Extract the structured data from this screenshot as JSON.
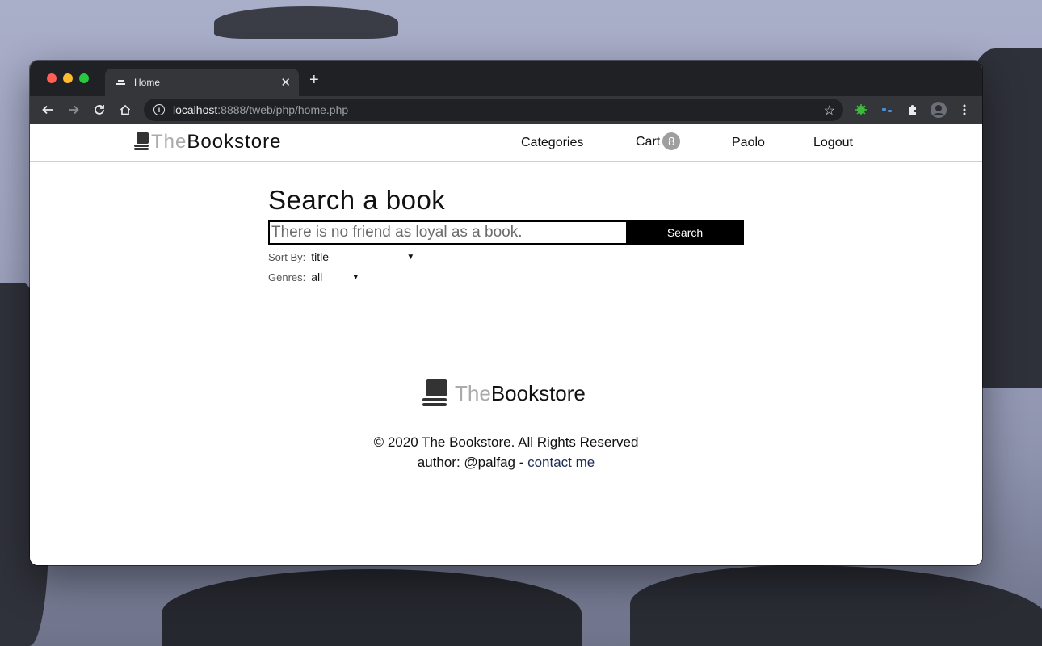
{
  "browser": {
    "tab_title": "Home",
    "url_host": "localhost",
    "url_path": ":8888/tweb/php/home.php"
  },
  "site": {
    "logo_the": "The",
    "logo_brand": "Bookstore",
    "nav": {
      "categories": "Categories",
      "cart": "Cart",
      "cart_count": "8",
      "user": "Paolo",
      "logout": "Logout"
    }
  },
  "search": {
    "title": "Search a book",
    "placeholder": "There is no friend as loyal as a book.",
    "button": "Search",
    "sort_label": "Sort By:",
    "sort_value": "title",
    "genres_label": "Genres:",
    "genres_value": "all"
  },
  "footer": {
    "logo_the": "The",
    "logo_brand": "Bookstore",
    "copyright": "© 2020 The Bookstore. All Rights Reserved",
    "author_prefix": "author: @palfag - ",
    "contact_link": "contact me"
  }
}
